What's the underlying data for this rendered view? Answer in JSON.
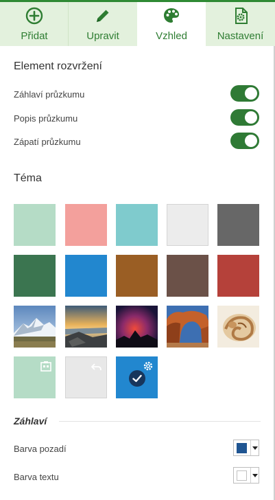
{
  "tabs": [
    {
      "label": "Přidat",
      "icon": "plus-circle-icon"
    },
    {
      "label": "Upravit",
      "icon": "pencil-icon"
    },
    {
      "label": "Vzhled",
      "icon": "palette-icon",
      "active": true
    },
    {
      "label": "Nastavení",
      "icon": "settings-document-icon"
    }
  ],
  "layout_section": {
    "title": "Element rozvržení",
    "toggles": [
      {
        "label": "Záhlaví průzkumu",
        "on": true
      },
      {
        "label": "Popis průzkumu",
        "on": true
      },
      {
        "label": "Zápatí průzkumu",
        "on": true
      }
    ]
  },
  "theme_section": {
    "title": "Téma",
    "color_tiles": [
      "#b5dcc6",
      "#f3a09c",
      "#7fcbcd",
      "#ececec",
      "#676767",
      "#3b7550",
      "#2287cf",
      "#9a5e24",
      "#6b5148",
      "#b5413a"
    ],
    "image_tiles": [
      "mountain-photo",
      "rocky-sunset-photo",
      "aurora-night-photo",
      "rock-arch-photo",
      "seashell-photo"
    ],
    "custom_tiles": [
      {
        "color": "#b5dcc6",
        "badge": "gallery-icon"
      },
      {
        "color": "#e8e8e8",
        "badge": "reset-arrow-icon"
      },
      {
        "color": "#2287cf",
        "badge": "gear-icon",
        "selected": true
      }
    ]
  },
  "header_section": {
    "title": "Záhlaví",
    "rows": [
      {
        "label": "Barva pozadí",
        "color": "#1f5592"
      },
      {
        "label": "Barva textu",
        "color": "#ffffff"
      }
    ]
  },
  "colors": {
    "accent": "#2e7d32",
    "tab_bar": "#e3f1dd",
    "toggle_on": "#2f7a35"
  }
}
